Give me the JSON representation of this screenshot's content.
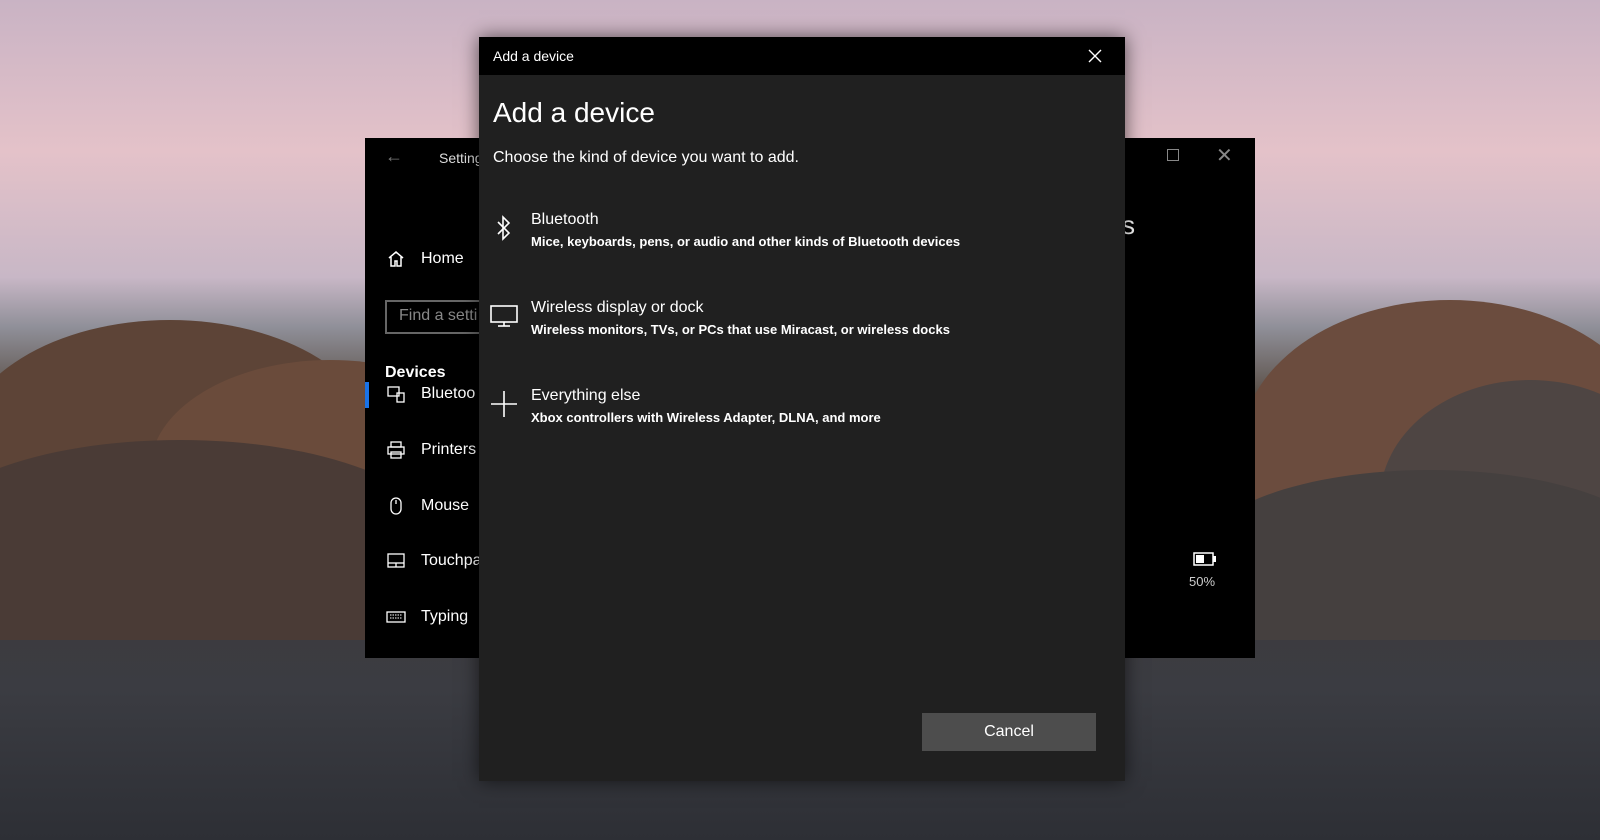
{
  "settings_window": {
    "title": "Setting",
    "back_icon": "back-arrow-icon",
    "sidebar": {
      "home_label": "Home",
      "search_placeholder": "Find a setti",
      "section_heading": "Devices",
      "items": [
        {
          "label": "Bluetoo",
          "icon": "bluetooth-devices-icon"
        },
        {
          "label": "Printers",
          "icon": "printer-icon"
        },
        {
          "label": "Mouse",
          "icon": "mouse-icon"
        },
        {
          "label": "Touchpa",
          "icon": "touchpad-icon"
        },
        {
          "label": "Typing",
          "icon": "keyboard-icon"
        }
      ]
    },
    "heading_tail": "s",
    "battery_level": "50%"
  },
  "dialog": {
    "title_bar": "Add a device",
    "heading": "Add a device",
    "subtitle": "Choose the kind of device you want to add.",
    "options": [
      {
        "title": "Bluetooth",
        "description": "Mice, keyboards, pens, or audio and other kinds of Bluetooth devices",
        "icon": "bluetooth-icon"
      },
      {
        "title": "Wireless display or dock",
        "description": "Wireless monitors, TVs, or PCs that use Miracast, or wireless docks",
        "icon": "monitor-icon"
      },
      {
        "title": "Everything else",
        "description": "Xbox controllers with Wireless Adapter, DLNA, and more",
        "icon": "plus-icon"
      }
    ],
    "cancel_label": "Cancel"
  }
}
